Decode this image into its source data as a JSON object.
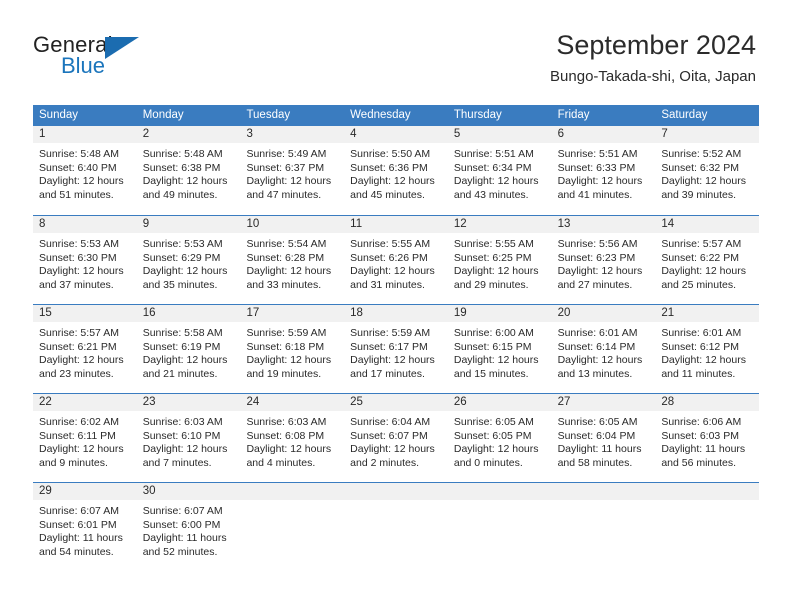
{
  "brand": {
    "name_part1": "General",
    "name_part2": "Blue",
    "flag_icon": "brand-flag-icon",
    "accent_color": "#1b75bc"
  },
  "header": {
    "title": "September 2024",
    "subtitle": "Bungo-Takada-shi, Oita, Japan"
  },
  "calendar": {
    "header_color": "#3a7cc0",
    "day_number_bg": "#f1f1f1",
    "weekdays": [
      "Sunday",
      "Monday",
      "Tuesday",
      "Wednesday",
      "Thursday",
      "Friday",
      "Saturday"
    ],
    "weeks": [
      [
        {
          "day": "1",
          "sunrise": "Sunrise: 5:48 AM",
          "sunset": "Sunset: 6:40 PM",
          "daylight_line1": "Daylight: 12 hours",
          "daylight_line2": "and 51 minutes."
        },
        {
          "day": "2",
          "sunrise": "Sunrise: 5:48 AM",
          "sunset": "Sunset: 6:38 PM",
          "daylight_line1": "Daylight: 12 hours",
          "daylight_line2": "and 49 minutes."
        },
        {
          "day": "3",
          "sunrise": "Sunrise: 5:49 AM",
          "sunset": "Sunset: 6:37 PM",
          "daylight_line1": "Daylight: 12 hours",
          "daylight_line2": "and 47 minutes."
        },
        {
          "day": "4",
          "sunrise": "Sunrise: 5:50 AM",
          "sunset": "Sunset: 6:36 PM",
          "daylight_line1": "Daylight: 12 hours",
          "daylight_line2": "and 45 minutes."
        },
        {
          "day": "5",
          "sunrise": "Sunrise: 5:51 AM",
          "sunset": "Sunset: 6:34 PM",
          "daylight_line1": "Daylight: 12 hours",
          "daylight_line2": "and 43 minutes."
        },
        {
          "day": "6",
          "sunrise": "Sunrise: 5:51 AM",
          "sunset": "Sunset: 6:33 PM",
          "daylight_line1": "Daylight: 12 hours",
          "daylight_line2": "and 41 minutes."
        },
        {
          "day": "7",
          "sunrise": "Sunrise: 5:52 AM",
          "sunset": "Sunset: 6:32 PM",
          "daylight_line1": "Daylight: 12 hours",
          "daylight_line2": "and 39 minutes."
        }
      ],
      [
        {
          "day": "8",
          "sunrise": "Sunrise: 5:53 AM",
          "sunset": "Sunset: 6:30 PM",
          "daylight_line1": "Daylight: 12 hours",
          "daylight_line2": "and 37 minutes."
        },
        {
          "day": "9",
          "sunrise": "Sunrise: 5:53 AM",
          "sunset": "Sunset: 6:29 PM",
          "daylight_line1": "Daylight: 12 hours",
          "daylight_line2": "and 35 minutes."
        },
        {
          "day": "10",
          "sunrise": "Sunrise: 5:54 AM",
          "sunset": "Sunset: 6:28 PM",
          "daylight_line1": "Daylight: 12 hours",
          "daylight_line2": "and 33 minutes."
        },
        {
          "day": "11",
          "sunrise": "Sunrise: 5:55 AM",
          "sunset": "Sunset: 6:26 PM",
          "daylight_line1": "Daylight: 12 hours",
          "daylight_line2": "and 31 minutes."
        },
        {
          "day": "12",
          "sunrise": "Sunrise: 5:55 AM",
          "sunset": "Sunset: 6:25 PM",
          "daylight_line1": "Daylight: 12 hours",
          "daylight_line2": "and 29 minutes."
        },
        {
          "day": "13",
          "sunrise": "Sunrise: 5:56 AM",
          "sunset": "Sunset: 6:23 PM",
          "daylight_line1": "Daylight: 12 hours",
          "daylight_line2": "and 27 minutes."
        },
        {
          "day": "14",
          "sunrise": "Sunrise: 5:57 AM",
          "sunset": "Sunset: 6:22 PM",
          "daylight_line1": "Daylight: 12 hours",
          "daylight_line2": "and 25 minutes."
        }
      ],
      [
        {
          "day": "15",
          "sunrise": "Sunrise: 5:57 AM",
          "sunset": "Sunset: 6:21 PM",
          "daylight_line1": "Daylight: 12 hours",
          "daylight_line2": "and 23 minutes."
        },
        {
          "day": "16",
          "sunrise": "Sunrise: 5:58 AM",
          "sunset": "Sunset: 6:19 PM",
          "daylight_line1": "Daylight: 12 hours",
          "daylight_line2": "and 21 minutes."
        },
        {
          "day": "17",
          "sunrise": "Sunrise: 5:59 AM",
          "sunset": "Sunset: 6:18 PM",
          "daylight_line1": "Daylight: 12 hours",
          "daylight_line2": "and 19 minutes."
        },
        {
          "day": "18",
          "sunrise": "Sunrise: 5:59 AM",
          "sunset": "Sunset: 6:17 PM",
          "daylight_line1": "Daylight: 12 hours",
          "daylight_line2": "and 17 minutes."
        },
        {
          "day": "19",
          "sunrise": "Sunrise: 6:00 AM",
          "sunset": "Sunset: 6:15 PM",
          "daylight_line1": "Daylight: 12 hours",
          "daylight_line2": "and 15 minutes."
        },
        {
          "day": "20",
          "sunrise": "Sunrise: 6:01 AM",
          "sunset": "Sunset: 6:14 PM",
          "daylight_line1": "Daylight: 12 hours",
          "daylight_line2": "and 13 minutes."
        },
        {
          "day": "21",
          "sunrise": "Sunrise: 6:01 AM",
          "sunset": "Sunset: 6:12 PM",
          "daylight_line1": "Daylight: 12 hours",
          "daylight_line2": "and 11 minutes."
        }
      ],
      [
        {
          "day": "22",
          "sunrise": "Sunrise: 6:02 AM",
          "sunset": "Sunset: 6:11 PM",
          "daylight_line1": "Daylight: 12 hours",
          "daylight_line2": "and 9 minutes."
        },
        {
          "day": "23",
          "sunrise": "Sunrise: 6:03 AM",
          "sunset": "Sunset: 6:10 PM",
          "daylight_line1": "Daylight: 12 hours",
          "daylight_line2": "and 7 minutes."
        },
        {
          "day": "24",
          "sunrise": "Sunrise: 6:03 AM",
          "sunset": "Sunset: 6:08 PM",
          "daylight_line1": "Daylight: 12 hours",
          "daylight_line2": "and 4 minutes."
        },
        {
          "day": "25",
          "sunrise": "Sunrise: 6:04 AM",
          "sunset": "Sunset: 6:07 PM",
          "daylight_line1": "Daylight: 12 hours",
          "daylight_line2": "and 2 minutes."
        },
        {
          "day": "26",
          "sunrise": "Sunrise: 6:05 AM",
          "sunset": "Sunset: 6:05 PM",
          "daylight_line1": "Daylight: 12 hours",
          "daylight_line2": "and 0 minutes."
        },
        {
          "day": "27",
          "sunrise": "Sunrise: 6:05 AM",
          "sunset": "Sunset: 6:04 PM",
          "daylight_line1": "Daylight: 11 hours",
          "daylight_line2": "and 58 minutes."
        },
        {
          "day": "28",
          "sunrise": "Sunrise: 6:06 AM",
          "sunset": "Sunset: 6:03 PM",
          "daylight_line1": "Daylight: 11 hours",
          "daylight_line2": "and 56 minutes."
        }
      ],
      [
        {
          "day": "29",
          "sunrise": "Sunrise: 6:07 AM",
          "sunset": "Sunset: 6:01 PM",
          "daylight_line1": "Daylight: 11 hours",
          "daylight_line2": "and 54 minutes."
        },
        {
          "day": "30",
          "sunrise": "Sunrise: 6:07 AM",
          "sunset": "Sunset: 6:00 PM",
          "daylight_line1": "Daylight: 11 hours",
          "daylight_line2": "and 52 minutes."
        },
        {
          "day": "",
          "sunrise": "",
          "sunset": "",
          "daylight_line1": "",
          "daylight_line2": ""
        },
        {
          "day": "",
          "sunrise": "",
          "sunset": "",
          "daylight_line1": "",
          "daylight_line2": ""
        },
        {
          "day": "",
          "sunrise": "",
          "sunset": "",
          "daylight_line1": "",
          "daylight_line2": ""
        },
        {
          "day": "",
          "sunrise": "",
          "sunset": "",
          "daylight_line1": "",
          "daylight_line2": ""
        },
        {
          "day": "",
          "sunrise": "",
          "sunset": "",
          "daylight_line1": "",
          "daylight_line2": ""
        }
      ]
    ]
  }
}
